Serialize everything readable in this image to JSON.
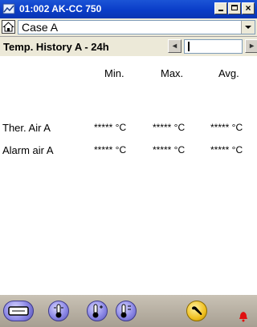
{
  "window": {
    "title": "01:002 AK-CC 750",
    "buttons": {
      "minimize": "minimize",
      "maximize": "maximize",
      "close": "×"
    }
  },
  "casebar": {
    "selected_case": "Case A"
  },
  "history": {
    "title": "Temp. History A - 24h",
    "prev_label": "◂",
    "next_label": "▸"
  },
  "table": {
    "headers": {
      "min": "Min.",
      "max": "Max.",
      "avg": "Avg."
    },
    "rows": [
      {
        "label": "Ther. Air A",
        "min": "***** °C",
        "max": "***** °C",
        "avg": "***** °C"
      },
      {
        "label": "Alarm air A",
        "min": "***** °C",
        "max": "***** °C",
        "avg": "***** °C"
      }
    ]
  },
  "toolbar": {
    "icons": [
      "case-display-icon",
      "thermometer-icon",
      "thermometer-plus-icon",
      "thermometer-settings-icon",
      "service-wrench-icon",
      "alarm-bell-icon"
    ]
  },
  "colors": {
    "titlebar": "#0a3dc8",
    "panel": "#ece9d8",
    "toolbar_button": "#8c88e6",
    "service_button": "#f0c020",
    "alarm": "#e01010"
  }
}
